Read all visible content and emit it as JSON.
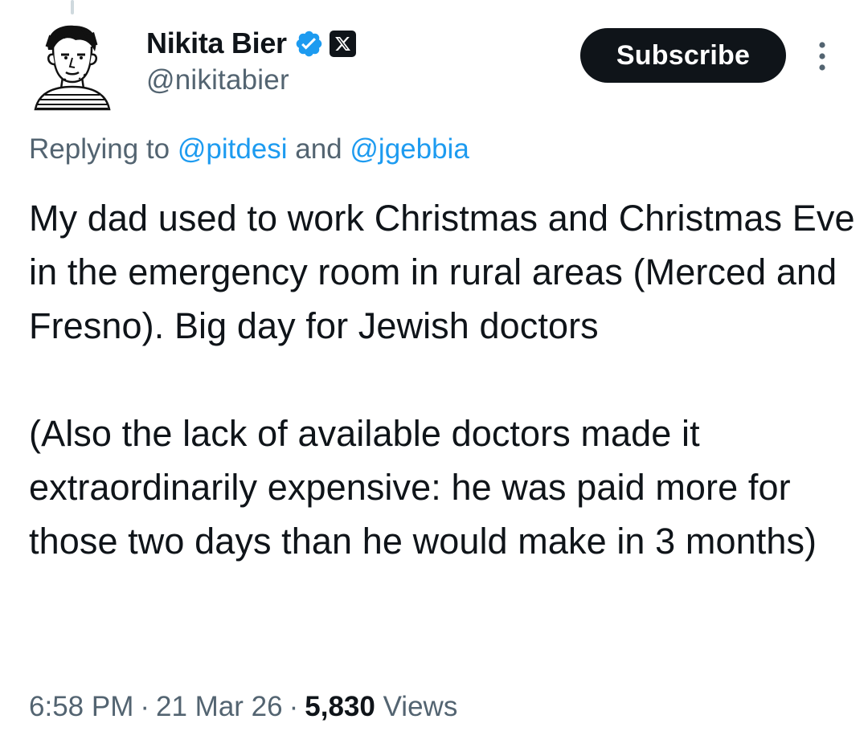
{
  "author": {
    "display_name": "Nikita Bier",
    "handle": "@nikitabier",
    "avatar_icon": "sketch-portrait-avatar",
    "verified_icon": "verified-badge-icon",
    "affiliation_icon": "x-logo-icon"
  },
  "header": {
    "subscribe_label": "Subscribe",
    "more_icon": "vertical-ellipsis-icon"
  },
  "reply": {
    "prefix": "Replying to ",
    "mention_1": "@pitdesi",
    "joiner": " and ",
    "mention_2": "@jgebbia"
  },
  "tweet": {
    "paragraph_1": "My dad used to work Christmas and Christmas Eve in the emergency room in rural areas (Merced and Fresno). Big day for Jewish doctors",
    "paragraph_2": "(Also the lack of available doctors made it extraordinarily expensive: he was paid more for those two days than he would make in 3 months)"
  },
  "meta": {
    "time": "6:58 PM",
    "date": "21 Mar 26",
    "separator": "·",
    "views_count": "5,830",
    "views_label": "Views"
  },
  "colors": {
    "text_primary": "#0f1419",
    "text_secondary": "#536471",
    "link": "#1d9bf0",
    "verified": "#1d9bf0",
    "button_bg": "#0f1419",
    "thread_line": "#cfd9de"
  }
}
